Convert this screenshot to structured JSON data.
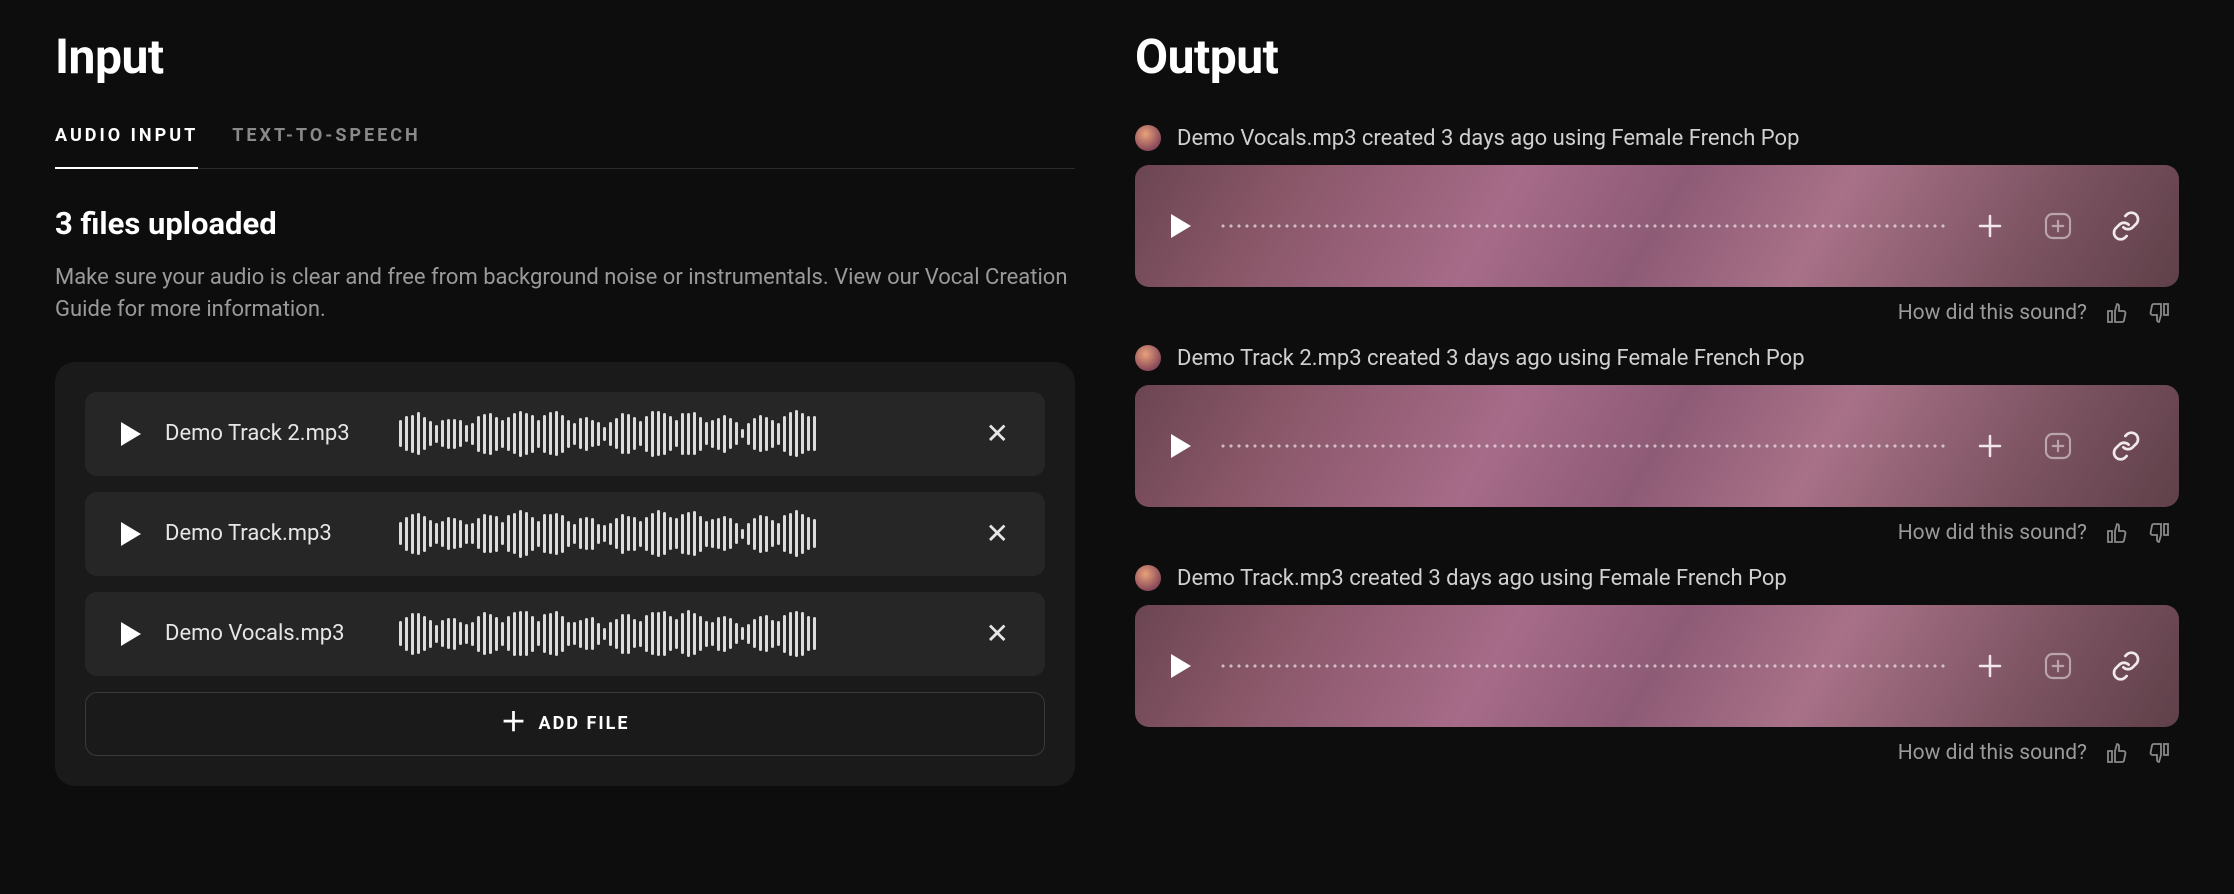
{
  "input": {
    "title": "Input",
    "tabs": [
      {
        "label": "AUDIO INPUT",
        "active": true
      },
      {
        "label": "TEXT-TO-SPEECH",
        "active": false
      }
    ],
    "upload_heading": "3 files uploaded",
    "upload_desc": "Make sure your audio is clear and free from background noise or instrumentals. View our Vocal Creation Guide for more information.",
    "files": [
      {
        "name": "Demo Track 2.mp3"
      },
      {
        "name": "Demo Track.mp3"
      },
      {
        "name": "Demo Vocals.mp3"
      }
    ],
    "add_file_label": "ADD FILE"
  },
  "output": {
    "title": "Output",
    "items": [
      {
        "meta": "Demo Vocals.mp3 created 3 days ago using Female French Pop"
      },
      {
        "meta": "Demo Track 2.mp3 created 3 days ago using Female French Pop"
      },
      {
        "meta": "Demo Track.mp3 created 3 days ago using Female French Pop"
      }
    ],
    "feedback_label": "How did this sound?"
  }
}
